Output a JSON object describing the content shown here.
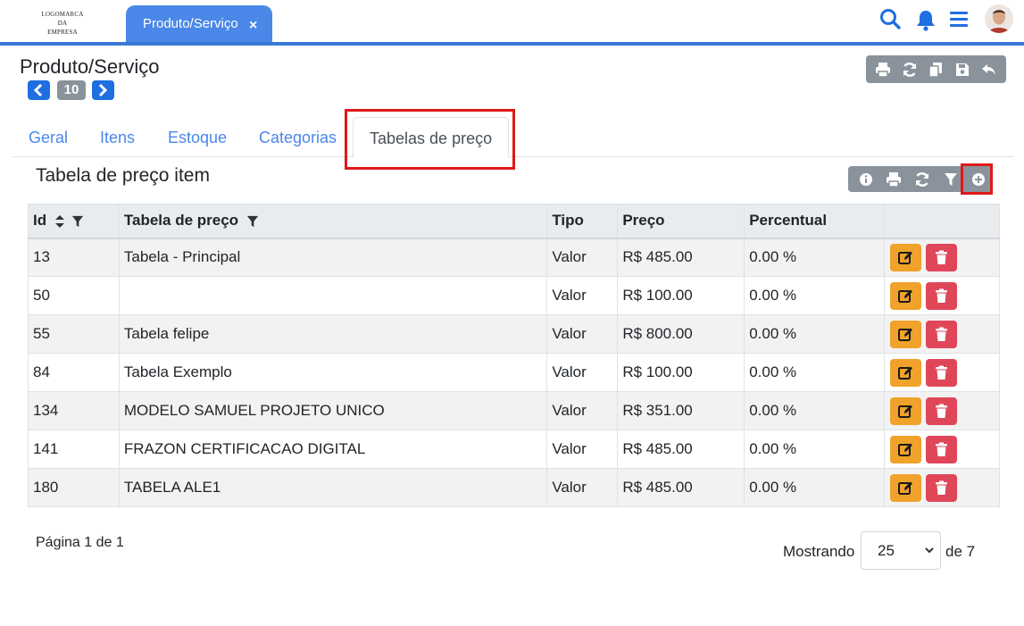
{
  "logo": {
    "line1": "LOGOMARCA",
    "line2": "DA",
    "line3": "EMPRESA"
  },
  "tab": {
    "label": "Produto/Serviço",
    "close": "×"
  },
  "topbar": {
    "icons": [
      "search-icon",
      "bell-icon",
      "menu-icon",
      "avatar"
    ]
  },
  "page": {
    "title": "Produto/Serviço",
    "record": "10"
  },
  "toolbar": {
    "icons": [
      "print-icon",
      "refresh-icon",
      "copy-icon",
      "save-icon",
      "undo-icon"
    ]
  },
  "tabs": [
    {
      "label": "Geral"
    },
    {
      "label": "Itens"
    },
    {
      "label": "Estoque"
    },
    {
      "label": "Categorias"
    },
    {
      "label": "Tabelas de preço",
      "active": true
    }
  ],
  "section": {
    "title": "Tabela de preço item"
  },
  "grid_toolbar": {
    "icons": [
      "info-icon",
      "print-icon",
      "refresh-icon",
      "filter-icon",
      "add-icon"
    ]
  },
  "table": {
    "columns": [
      "Id",
      "Tabela de preço",
      "Tipo",
      "Preço",
      "Percentual"
    ],
    "rows": [
      {
        "id": "13",
        "tabela": "Tabela - Principal",
        "tipo": "Valor",
        "preco": "R$ 485.00",
        "percentual": "0.00 %"
      },
      {
        "id": "50",
        "tabela": "",
        "tipo": "Valor",
        "preco": "R$ 100.00",
        "percentual": "0.00 %"
      },
      {
        "id": "55",
        "tabela": "Tabela felipe",
        "tipo": "Valor",
        "preco": "R$ 800.00",
        "percentual": "0.00 %"
      },
      {
        "id": "84",
        "tabela": "Tabela Exemplo",
        "tipo": "Valor",
        "preco": "R$ 100.00",
        "percentual": "0.00 %"
      },
      {
        "id": "134",
        "tabela": "MODELO SAMUEL PROJETO UNICO",
        "tipo": "Valor",
        "preco": "R$ 351.00",
        "percentual": "0.00 %"
      },
      {
        "id": "141",
        "tabela": "FRAZON CERTIFICACAO DIGITAL",
        "tipo": "Valor",
        "preco": "R$ 485.00",
        "percentual": "0.00 %"
      },
      {
        "id": "180",
        "tabela": "TABELA ALE1",
        "tipo": "Valor",
        "preco": "R$ 485.00",
        "percentual": "0.00 %"
      }
    ]
  },
  "pagination": {
    "page_info": "Página 1 de 1",
    "showing": "Mostrando",
    "page_size": "25",
    "total": "de 7"
  },
  "colors": {
    "primary": "#4a87e8",
    "nav_blue": "#1e6fe0",
    "secondary": "#8a929c",
    "warning": "#f0a22a",
    "danger": "#df4759",
    "highlight": "#e01818"
  }
}
